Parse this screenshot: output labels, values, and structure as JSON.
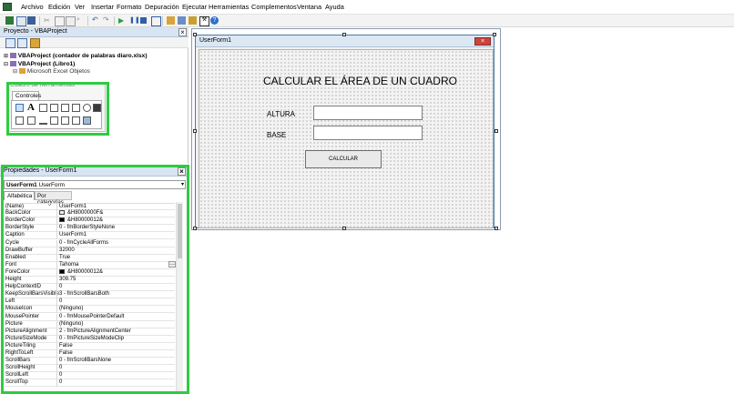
{
  "menu": [
    "Archivo",
    "Edición",
    "Ver",
    "Insertar",
    "Formato",
    "Depuración",
    "Ejecutar",
    "Herramientas",
    "Complementos",
    "Ventana",
    "Ayuda"
  ],
  "project": {
    "title": "Proyecto - VBAProject",
    "items": [
      "VBAProject (contador de palabras diaro.xlsx)",
      "VBAProject (Libro1)",
      "Microsoft Excel Objetos"
    ]
  },
  "toolbox": {
    "title": "Cuadro de herramientas",
    "tab": "Controles",
    "tool_a": "A"
  },
  "properties": {
    "title": "Propiedades - UserForm1",
    "object": "UserForm1",
    "object_type": "UserForm",
    "tabs": [
      "Alfabética",
      "Por categorías"
    ],
    "rows": [
      {
        "name": "(Name)",
        "value": "UserForm1"
      },
      {
        "name": "BackColor",
        "value": "&H8000000F&",
        "swatch": "#f0f0f0"
      },
      {
        "name": "BorderColor",
        "value": "&H80000012&",
        "swatch": "#000000"
      },
      {
        "name": "BorderStyle",
        "value": "0 - fmBorderStyleNone"
      },
      {
        "name": "Caption",
        "value": "UserForm1"
      },
      {
        "name": "Cycle",
        "value": "0 - fmCycleAllForms"
      },
      {
        "name": "DrawBuffer",
        "value": "32000"
      },
      {
        "name": "Enabled",
        "value": "True"
      },
      {
        "name": "Font",
        "value": "Tahoma"
      },
      {
        "name": "ForeColor",
        "value": "&H80000012&",
        "swatch": "#000000"
      },
      {
        "name": "Height",
        "value": "309.75"
      },
      {
        "name": "HelpContextID",
        "value": "0"
      },
      {
        "name": "KeepScrollBarsVisible",
        "value": "3 - fmScrollBarsBoth"
      },
      {
        "name": "Left",
        "value": "0"
      },
      {
        "name": "MouseIcon",
        "value": "(Ninguno)"
      },
      {
        "name": "MousePointer",
        "value": "0 - fmMousePointerDefault"
      },
      {
        "name": "Picture",
        "value": "(Ninguno)"
      },
      {
        "name": "PictureAlignment",
        "value": "2 - fmPictureAlignmentCenter"
      },
      {
        "name": "PictureSizeMode",
        "value": "0 - fmPictureSizeModeClip"
      },
      {
        "name": "PictureTiling",
        "value": "False"
      },
      {
        "name": "RightToLeft",
        "value": "False"
      },
      {
        "name": "ScrollBars",
        "value": "0 - fmScrollBarsNone"
      },
      {
        "name": "ScrollHeight",
        "value": "0"
      },
      {
        "name": "ScrollLeft",
        "value": "0"
      },
      {
        "name": "ScrollTop",
        "value": "0"
      }
    ]
  },
  "form": {
    "title": "UserForm1",
    "heading": "CALCULAR EL ÁREA DE UN CUADRO",
    "label_altura": "ALTURA",
    "label_base": "BASE",
    "button": "CALCULAR"
  },
  "colors": {
    "highlight": "#2ecc40",
    "title_bar": "#dce7f4",
    "close": "#c9463d"
  }
}
